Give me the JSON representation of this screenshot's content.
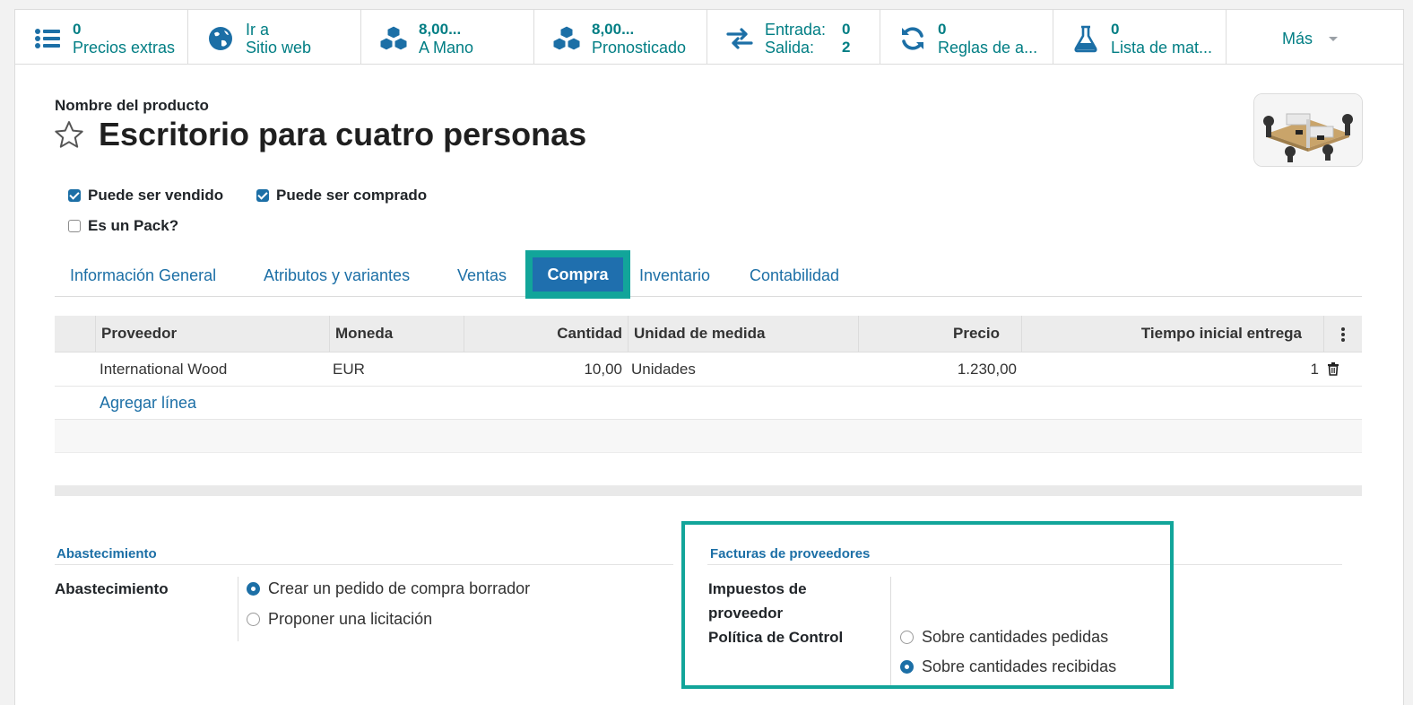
{
  "smart_buttons": [
    {
      "icon": "list-icon",
      "value": "0",
      "label": "Precios extras"
    },
    {
      "icon": "globe-icon",
      "line1": "Ir a",
      "label": "Sitio web"
    },
    {
      "icon": "cubes-icon",
      "value": "8,00...",
      "label": "A Mano"
    },
    {
      "icon": "cubes-icon",
      "value": "8,00...",
      "label": "Pronosticado"
    },
    {
      "icon": "exchange-icon",
      "in_label": "Entrada:",
      "in_value": "0",
      "out_label": "Salida:",
      "out_value": "2"
    },
    {
      "icon": "refresh-icon",
      "value": "0",
      "label": "Reglas de a..."
    },
    {
      "icon": "flask-icon",
      "value": "0",
      "label": "Lista de mat..."
    }
  ],
  "more_label": "Más",
  "product": {
    "name_label": "Nombre del producto",
    "name": "Escritorio para cuatro personas",
    "can_be_sold": "Puede ser vendido",
    "can_be_purchased": "Puede ser comprado",
    "is_pack": "Es un Pack?"
  },
  "tabs": [
    "Información General",
    "Atributos y variantes",
    "Ventas",
    "Compra",
    "Inventario",
    "Contabilidad"
  ],
  "active_tab": "Compra",
  "vendor_table": {
    "headers": [
      "Proveedor",
      "Moneda",
      "Cantidad",
      "Unidad de medida",
      "Precio",
      "Tiempo inicial entrega"
    ],
    "rows": [
      {
        "vendor": "International Wood",
        "currency": "EUR",
        "qty": "10,00",
        "uom": "Unidades",
        "price": "1.230,00",
        "delay": "1"
      }
    ],
    "add_line": "Agregar línea"
  },
  "procurement": {
    "section_title": "Abastecimiento",
    "field_label": "Abastecimiento",
    "options": [
      "Crear un pedido de compra borrador",
      "Proponer una licitación"
    ],
    "selected": 0
  },
  "vendor_bills": {
    "section_title": "Facturas de proveedores",
    "taxes_label_1": "Impuestos de",
    "taxes_label_2": "proveedor",
    "policy_label": "Política de Control",
    "options": [
      "Sobre cantidades pedidas",
      "Sobre cantidades recibidas"
    ],
    "selected": 1
  },
  "colors": {
    "accent": "#1c6fa6",
    "teal": "#017e84",
    "highlight": "#12a59a"
  }
}
